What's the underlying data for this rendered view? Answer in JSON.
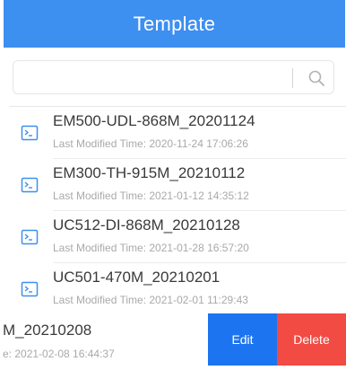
{
  "header": {
    "title": "Template"
  },
  "search": {
    "placeholder": "",
    "value": "",
    "icon": "search-icon"
  },
  "templates": [
    {
      "name": "EM500-UDL-868M_20201124",
      "modified": "Last Modified Time: 2020-11-24 17:06:26"
    },
    {
      "name": "EM300-TH-915M_20210112",
      "modified": "Last Modified Time: 2021-01-12 14:35:12"
    },
    {
      "name": "UC512-DI-868M_20210128",
      "modified": "Last Modified Time: 2021-01-28 16:57:20"
    },
    {
      "name": "UC501-470M_20210201",
      "modified": "Last Modified Time: 2021-02-01 11:29:43"
    }
  ],
  "swiped_item": {
    "name": "M_20210208",
    "modified": "e: 2021-02-08 16:44:37",
    "actions": {
      "edit_label": "Edit",
      "delete_label": "Delete"
    }
  },
  "colors": {
    "header": "#3d8ff0",
    "edit": "#1d74f0",
    "delete": "#f24b43",
    "icon": "#3d8ff0"
  }
}
